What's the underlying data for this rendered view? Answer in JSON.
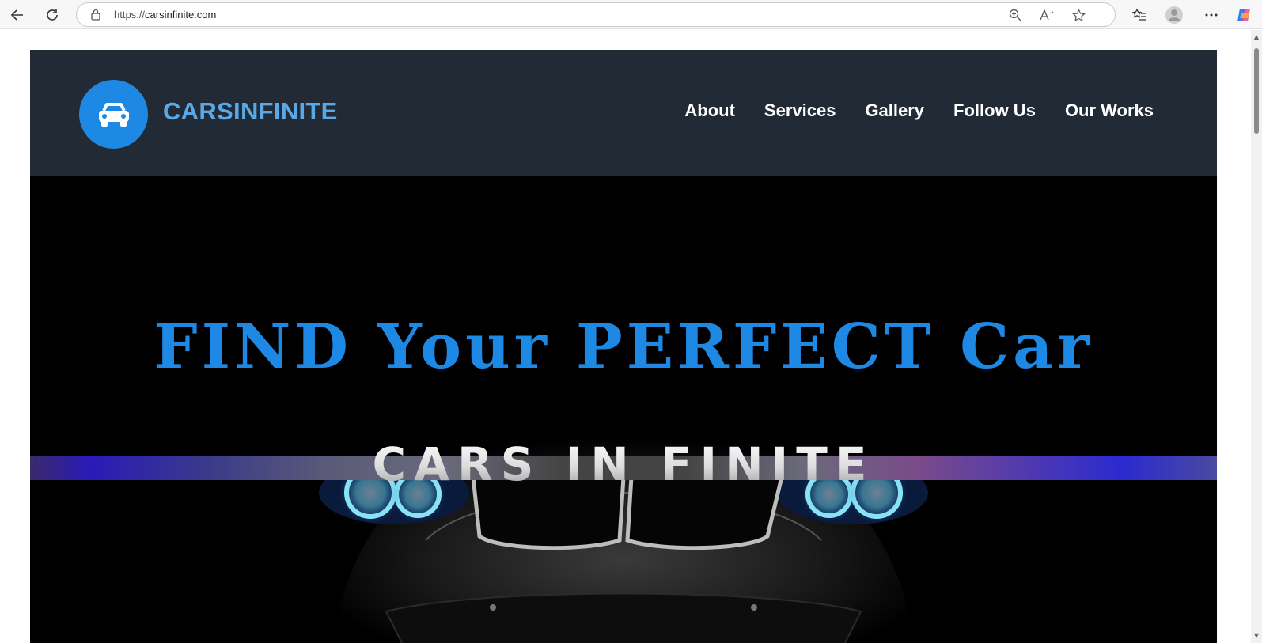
{
  "browser": {
    "url_scheme": "https://",
    "url_host": "carsinfinite.com",
    "icons": {
      "back": "arrow-left-icon",
      "refresh": "refresh-icon",
      "lock": "lock-icon",
      "zoom": "zoom-icon",
      "read_aloud": "read-aloud-icon",
      "favorite": "star-icon",
      "favorites": "favorites-icon",
      "profile": "profile-icon",
      "menu": "more-icon",
      "copilot": "copilot-icon"
    }
  },
  "site": {
    "brand": "CARSINFINITE",
    "logo_icon": "car-icon",
    "nav": [
      {
        "label": "About"
      },
      {
        "label": "Services"
      },
      {
        "label": "Gallery"
      },
      {
        "label": "Follow Us"
      },
      {
        "label": "Our Works"
      }
    ],
    "hero": {
      "title": "FIND Your PERFECT Car",
      "brand_text": "CARS IN FINITE"
    },
    "colors": {
      "header_bg": "#222a36",
      "accent": "#1e88e5",
      "brand_text": "#5aa9e6",
      "hero_bg": "#000000"
    }
  }
}
